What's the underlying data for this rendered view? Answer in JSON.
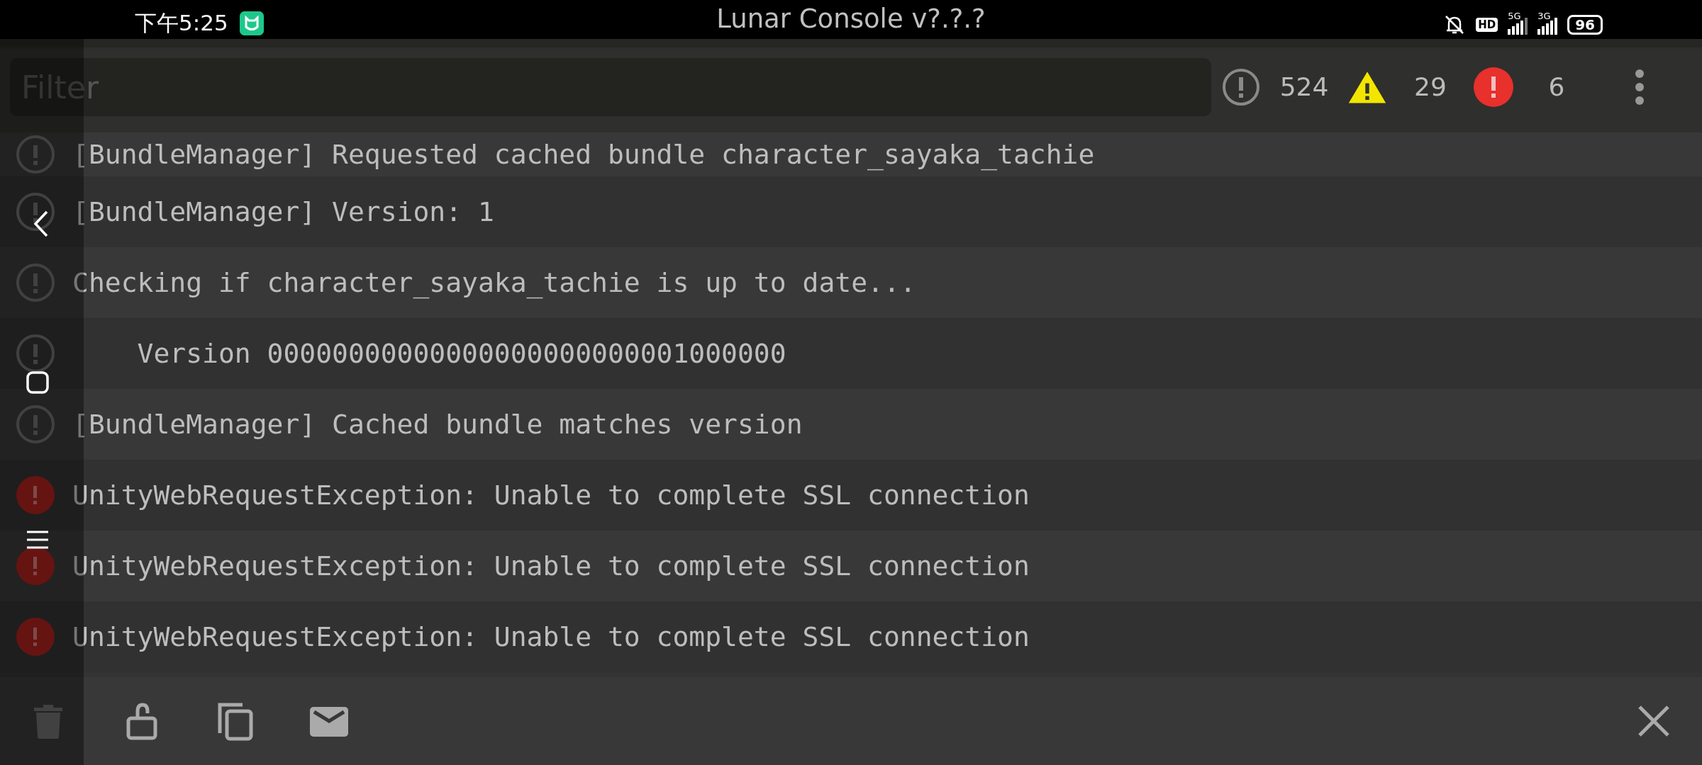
{
  "status_bar": {
    "time": "下午5:25",
    "title": "Lunar Console v?.?.?",
    "hd": "HD",
    "sim1": "5G",
    "sim2": "3G",
    "battery": "96"
  },
  "toolbar": {
    "filter": {
      "placeholder": "Filter"
    },
    "counters": [
      {
        "kind": "log",
        "count": "524"
      },
      {
        "kind": "warning",
        "count": "29"
      },
      {
        "kind": "error",
        "count": "6"
      }
    ]
  },
  "log": [
    {
      "kind": "log",
      "text": "[BundleManager] Requested cached bundle character_sayaka_tachie"
    },
    {
      "kind": "log",
      "text": "[BundleManager] Version: 1"
    },
    {
      "kind": "log",
      "text": "Checking if character_sayaka_tachie is up to date..."
    },
    {
      "kind": "log",
      "text": "    Version 00000000000000000000000001000000"
    },
    {
      "kind": "log",
      "text": "[BundleManager] Cached bundle matches version"
    },
    {
      "kind": "error",
      "text": "UnityWebRequestException: Unable to complete SSL connection"
    },
    {
      "kind": "error",
      "text": "UnityWebRequestException: Unable to complete SSL connection"
    },
    {
      "kind": "error",
      "text": "UnityWebRequestException: Unable to complete SSL connection"
    }
  ]
}
